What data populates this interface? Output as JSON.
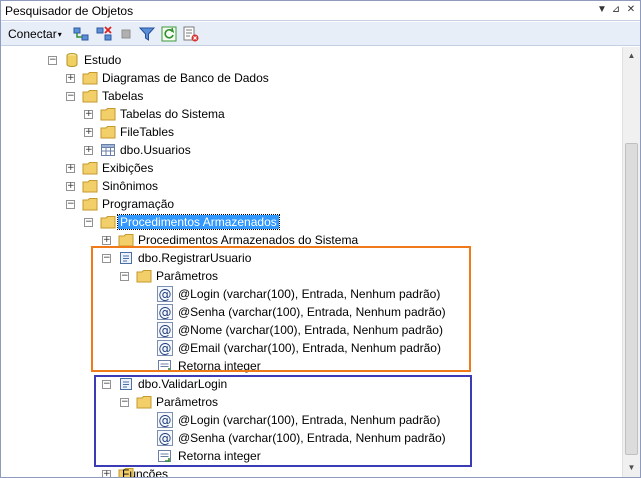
{
  "window": {
    "title": "Pesquisador de Objetos",
    "pin_glyph": "▼",
    "dock_glyph": "⊿",
    "close_glyph": "✕"
  },
  "toolbar": {
    "connect_label": "Conectar",
    "connect_arrow": "▾",
    "tools": [
      "connect-icon",
      "disconnect-icon",
      "stop-icon",
      "filter-icon",
      "refresh-icon",
      "disconnect-all-icon"
    ]
  },
  "tree": {
    "estudo": "Estudo",
    "diagramas": "Diagramas de Banco de Dados",
    "tabelas": "Tabelas",
    "tabelas_sistema": "Tabelas do Sistema",
    "filetables": "FileTables",
    "dbo_usuarios": "dbo.Usuarios",
    "exibicoes": "Exibições",
    "sinonimos": "Sinônimos",
    "programacao": "Programação",
    "procedimentos": "Procedimentos Armazenados",
    "procedimentos_sistema": "Procedimentos Armazenados do Sistema",
    "registrar": {
      "name": "dbo.RegistrarUsuario",
      "params_label": "Parâmetros",
      "params": [
        "@Login (varchar(100), Entrada, Nenhum padrão)",
        "@Senha (varchar(100), Entrada, Nenhum padrão)",
        "@Nome (varchar(100), Entrada, Nenhum padrão)",
        "@Email (varchar(100), Entrada, Nenhum padrão)"
      ],
      "returns": "Retorna integer"
    },
    "validar": {
      "name": "dbo.ValidarLogin",
      "params_label": "Parâmetros",
      "params": [
        "@Login (varchar(100), Entrada, Nenhum padrão)",
        "@Senha (varchar(100), Entrada, Nenhum padrão)"
      ],
      "returns": "Retorna integer"
    },
    "funcoes": "Funções",
    "expand_plus": "+",
    "expand_minus": "−"
  },
  "colors": {
    "selection": "#3399ff",
    "highlight_orange": "#f07a1a",
    "highlight_blue": "#3b3bb6",
    "folder": "#f3cf6a"
  }
}
